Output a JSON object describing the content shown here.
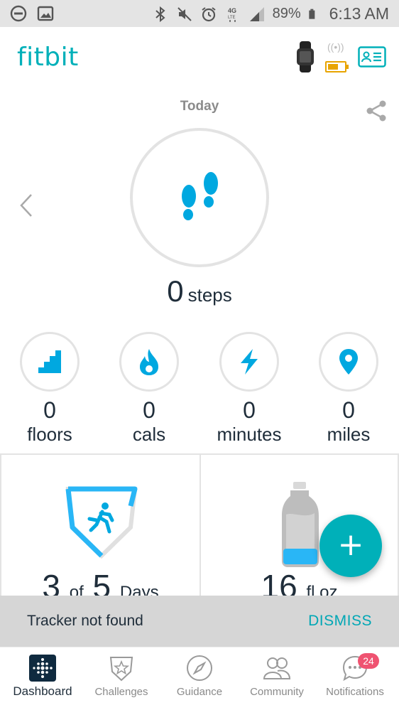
{
  "status_bar": {
    "battery_percent": "89%",
    "time": "6:13 AM",
    "network": "4G LTE"
  },
  "header": {
    "brand": "fitbit"
  },
  "today": {
    "label": "Today",
    "steps_value": "0",
    "steps_unit": "steps"
  },
  "stats": [
    {
      "value": "0",
      "unit": "floors",
      "icon": "stairs-icon"
    },
    {
      "value": "0",
      "unit": "cals",
      "icon": "flame-icon"
    },
    {
      "value": "0",
      "unit": "minutes",
      "icon": "lightning-icon"
    },
    {
      "value": "0",
      "unit": "miles",
      "icon": "location-pin-icon"
    }
  ],
  "cards": {
    "exercise": {
      "main_a": "3",
      "of": "of",
      "main_b": "5",
      "unit": "Days"
    },
    "water": {
      "value": "16",
      "unit": "fl oz"
    }
  },
  "fab": {
    "label": "+"
  },
  "snackbar": {
    "message": "Tracker not found",
    "action": "DISMISS"
  },
  "bottom_nav": {
    "items": [
      {
        "label": "Dashboard"
      },
      {
        "label": "Challenges"
      },
      {
        "label": "Guidance"
      },
      {
        "label": "Community"
      },
      {
        "label": "Notifications"
      }
    ],
    "notifications_badge": "24"
  },
  "colors": {
    "accent": "#00b0b9",
    "steps_blue": "#00a8e0",
    "battery": "#e8a400",
    "badge": "#ef5371"
  }
}
